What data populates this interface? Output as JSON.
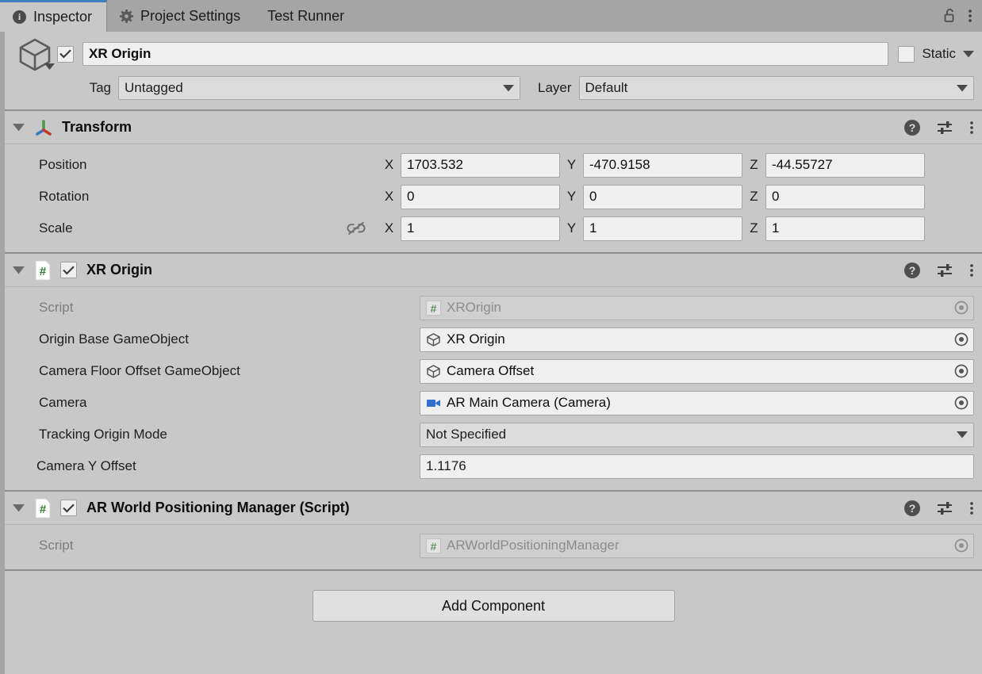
{
  "window": {
    "tabs": [
      {
        "label": "Inspector",
        "icon": "info-icon",
        "active": true
      },
      {
        "label": "Project Settings",
        "icon": "gear-icon",
        "active": false
      },
      {
        "label": "Test Runner",
        "icon": "none",
        "active": false
      }
    ],
    "lock_icon": "padlock-open-icon",
    "menu_icon": "kebab-menu-icon"
  },
  "gameobject": {
    "enabled_checkbox": true,
    "icon": "cube-outline-icon",
    "name": "XR Origin",
    "static_label": "Static",
    "static_checked": false,
    "tag_label": "Tag",
    "tag_value": "Untagged",
    "layer_label": "Layer",
    "layer_value": "Default"
  },
  "transform": {
    "title": "Transform",
    "icon": "transform-axis-gizmo-icon",
    "expanded": true,
    "rows": [
      {
        "label": "Position",
        "x": "1703.532",
        "y": "-470.9158",
        "z": "-44.55727",
        "chain": false
      },
      {
        "label": "Rotation",
        "x": "0",
        "y": "0",
        "z": "0",
        "chain": false
      },
      {
        "label": "Scale",
        "x": "1",
        "y": "1",
        "z": "1",
        "chain": true
      }
    ],
    "axis_labels": {
      "x": "X",
      "y": "Y",
      "z": "Z"
    },
    "chain_icon": "chain-link-broken-icon"
  },
  "xr_origin": {
    "title": "XR Origin",
    "icon": "csharp-script-icon",
    "enabled_checkbox": true,
    "expanded": true,
    "fields": [
      {
        "label": "Script",
        "value": "XROrigin",
        "kind": "object",
        "icon": "csharp-script-icon",
        "disabled": true
      },
      {
        "label": "Origin Base GameObject",
        "value": "XR Origin",
        "kind": "object",
        "icon": "cube-outline-icon",
        "disabled": false
      },
      {
        "label": "Camera Floor Offset GameObject",
        "value": "Camera Offset",
        "kind": "object",
        "icon": "cube-outline-icon",
        "disabled": false
      },
      {
        "label": "Camera",
        "value": "AR Main Camera (Camera)",
        "kind": "object",
        "icon": "camera-icon",
        "disabled": false
      },
      {
        "label": "Tracking Origin Mode",
        "value": "Not Specified",
        "kind": "dropdown",
        "icon": "none",
        "disabled": false
      },
      {
        "label": "Camera Y Offset",
        "value": "1.1176",
        "kind": "text",
        "icon": "none",
        "disabled": false,
        "indent": true
      }
    ]
  },
  "ar_world_positioning_manager": {
    "title": "AR World Positioning Manager (Script)",
    "icon": "csharp-script-icon",
    "enabled_checkbox": true,
    "expanded": true,
    "fields": [
      {
        "label": "Script",
        "value": "ARWorldPositioningManager",
        "kind": "object",
        "icon": "csharp-script-icon",
        "disabled": true
      }
    ]
  },
  "footer": {
    "add_component_label": "Add Component"
  },
  "component_tools": {
    "help_icon": "help-question-icon",
    "preset_icon": "preset-sliders-icon",
    "menu_icon": "kebab-menu-icon"
  },
  "colors": {
    "window_bg": "#c8c8c8",
    "tabbar_bg": "#a5a5a5",
    "active_tab_accent": "#3f7fbf",
    "field_bg": "#efefef",
    "dropdown_bg": "#dcdcdc",
    "script_green": "#5e8f5e",
    "camera_blue": "#2f6fd0"
  }
}
